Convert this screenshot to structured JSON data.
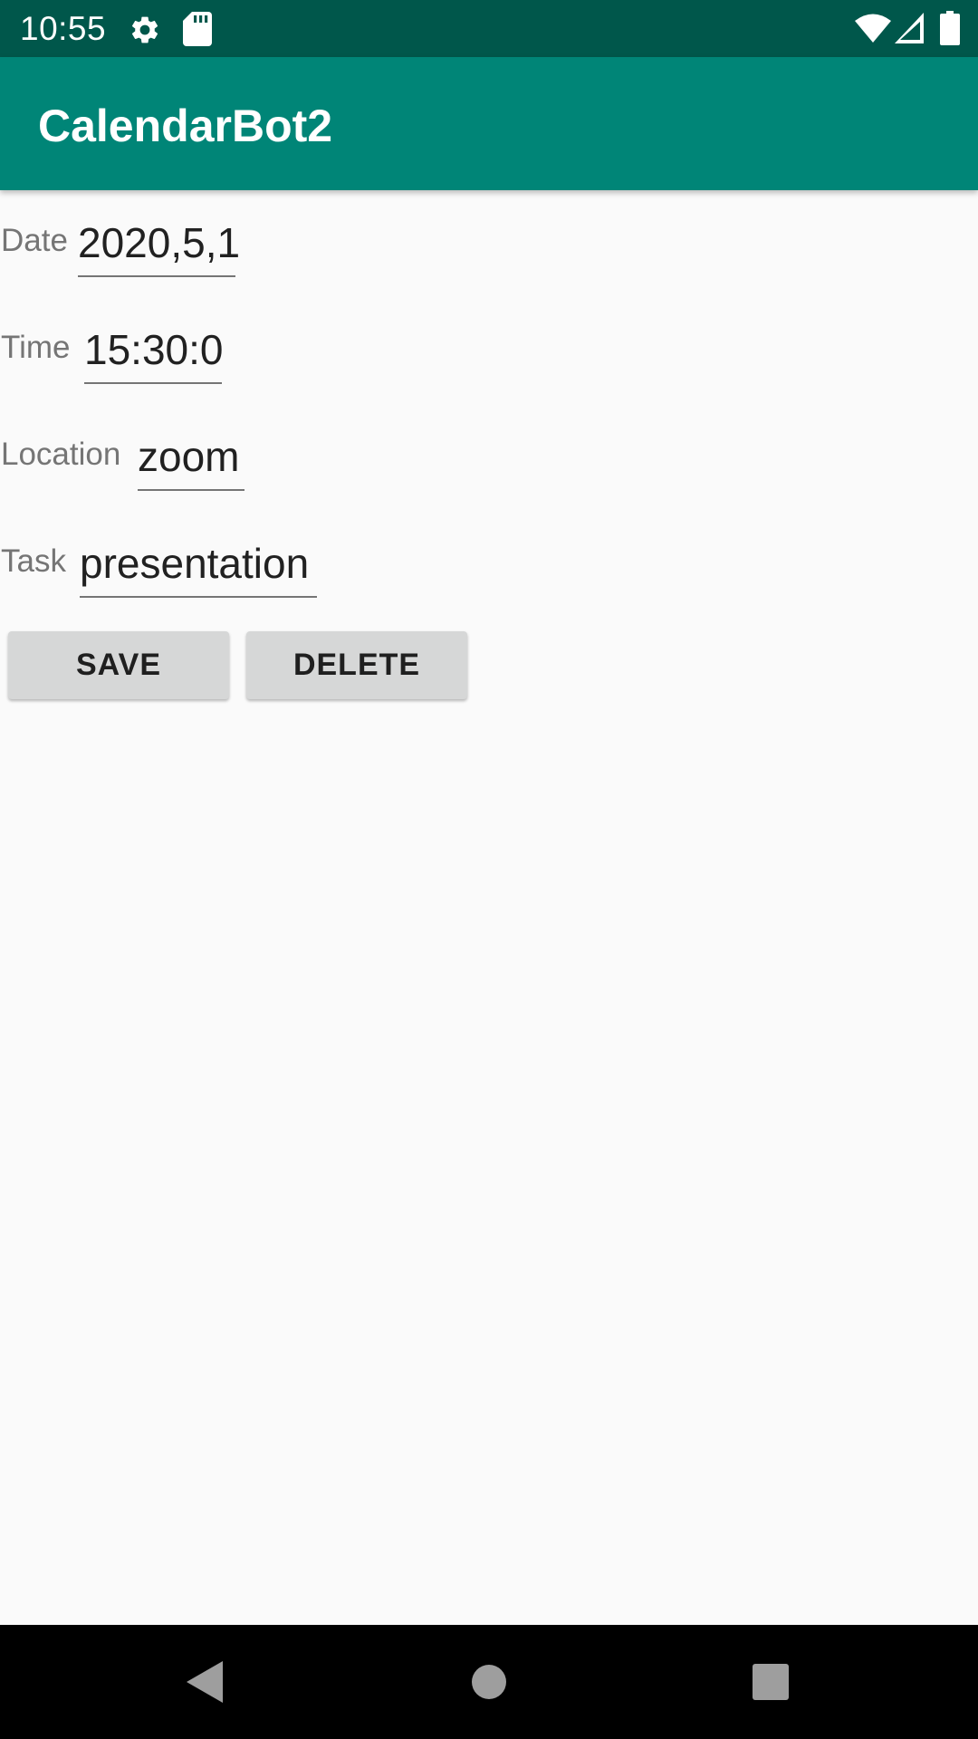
{
  "status_bar": {
    "time": "10:55",
    "icons": [
      "settings-icon",
      "sd-card-icon",
      "wifi-icon",
      "signal-icon",
      "battery-icon"
    ]
  },
  "app_bar": {
    "title": "CalendarBot2",
    "color": "#008577"
  },
  "form": {
    "date": {
      "label": "Date",
      "value": "2020,5,1"
    },
    "time": {
      "label": "Time",
      "value": "15:30:0"
    },
    "location": {
      "label": "Location",
      "value": "zoom"
    },
    "task": {
      "label": "Task",
      "value": "presentation"
    }
  },
  "buttons": {
    "save_label": "SAVE",
    "delete_label": "DELETE"
  },
  "nav_bar": {
    "icons": [
      "back-icon",
      "home-icon",
      "recents-icon"
    ]
  }
}
